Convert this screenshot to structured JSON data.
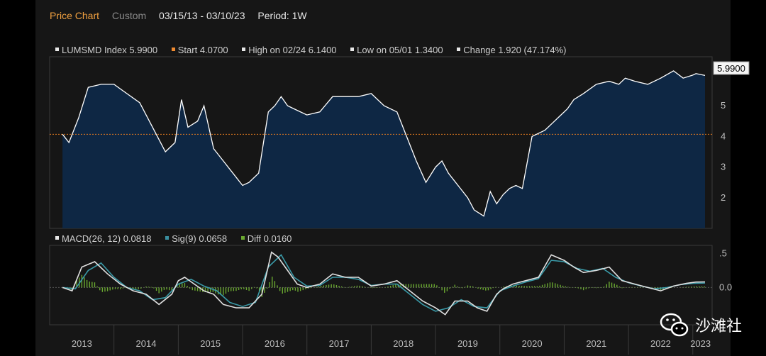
{
  "toolbar": {
    "title": "Price Chart",
    "mode": "Custom",
    "date_range": "03/15/13 - 03/10/23",
    "period": "Period: 1W"
  },
  "price_legend": [
    {
      "label": "LUMSMD Index 5.9900",
      "color": "#e8e8e8"
    },
    {
      "label": "Start 4.0700",
      "color": "#f08a30"
    },
    {
      "label": "High on 02/24 6.1400",
      "color": "#e8e8e8"
    },
    {
      "label": "Low on 05/01 1.3400",
      "color": "#e8e8e8"
    },
    {
      "label": "Change 1.920 (47.174%)",
      "color": "#e8e8e8"
    }
  ],
  "macd_legend": [
    {
      "label": "MACD(26, 12) 0.0818",
      "color": "#e8e8e8"
    },
    {
      "label": "Sig(9) 0.0658",
      "color": "#3a8fa0"
    },
    {
      "label": "Diff 0.0160",
      "color": "#6aa830"
    }
  ],
  "last_price_tag": "5.9900",
  "watermark": "沙滩社",
  "colors": {
    "area_fill": "#0e2744",
    "price_line": "#ffffff",
    "start_line": "#e07a20",
    "macd_line": "#e0e0e0",
    "signal_line": "#3a9aa8",
    "diff_bar": "#6aa830"
  },
  "chart_data": [
    {
      "type": "area",
      "series": [
        {
          "name": "LUMSMD Index"
        }
      ],
      "x": [
        2013.2,
        2013.3,
        2013.45,
        2013.6,
        2013.8,
        2014.0,
        2014.2,
        2014.4,
        2014.6,
        2014.8,
        2014.95,
        2015.05,
        2015.15,
        2015.3,
        2015.4,
        2015.55,
        2015.7,
        2015.85,
        2016.0,
        2016.1,
        2016.25,
        2016.4,
        2016.5,
        2016.6,
        2016.7,
        2016.8,
        2017.0,
        2017.2,
        2017.4,
        2017.6,
        2017.8,
        2018.0,
        2018.2,
        2018.4,
        2018.55,
        2018.7,
        2018.85,
        2019.0,
        2019.1,
        2019.2,
        2019.35,
        2019.5,
        2019.6,
        2019.75,
        2019.85,
        2019.95,
        2020.05,
        2020.15,
        2020.25,
        2020.35,
        2020.5,
        2020.7,
        2020.85,
        2020.95,
        2021.05,
        2021.15,
        2021.3,
        2021.5,
        2021.7,
        2021.85,
        2021.95,
        2022.1,
        2022.3,
        2022.5,
        2022.7,
        2022.85,
        2023.0,
        2023.05,
        2023.19
      ],
      "y": [
        4.07,
        3.8,
        4.6,
        5.6,
        5.7,
        5.7,
        5.4,
        5.1,
        4.3,
        3.5,
        3.8,
        5.2,
        4.3,
        4.5,
        5.0,
        3.6,
        3.2,
        2.8,
        2.4,
        2.5,
        2.8,
        4.8,
        5.0,
        5.3,
        5.0,
        4.9,
        4.7,
        4.8,
        5.3,
        5.3,
        5.3,
        5.4,
        5.0,
        4.8,
        4.0,
        3.2,
        2.5,
        3.0,
        3.2,
        2.8,
        2.4,
        2.0,
        1.6,
        1.4,
        2.2,
        1.8,
        2.1,
        2.3,
        2.4,
        2.3,
        4.0,
        4.2,
        4.5,
        4.7,
        4.9,
        5.2,
        5.4,
        5.7,
        5.8,
        5.7,
        5.9,
        5.8,
        5.7,
        5.9,
        6.14,
        5.9,
        6.0,
        6.05,
        5.99
      ],
      "start": 4.07,
      "yticks": [
        2,
        3,
        4,
        5
      ],
      "ylim": [
        1.0,
        6.6
      ],
      "last_value": 5.99
    },
    {
      "type": "line",
      "series": [
        {
          "name": "MACD(26, 12)",
          "x": [
            2013.2,
            2013.35,
            2013.5,
            2013.7,
            2013.9,
            2014.1,
            2014.3,
            2014.5,
            2014.7,
            2014.9,
            2015.0,
            2015.1,
            2015.25,
            2015.4,
            2015.55,
            2015.7,
            2015.9,
            2016.1,
            2016.3,
            2016.45,
            2016.55,
            2016.7,
            2016.85,
            2017.0,
            2017.2,
            2017.4,
            2017.6,
            2017.8,
            2018.0,
            2018.2,
            2018.4,
            2018.6,
            2018.8,
            2019.0,
            2019.15,
            2019.3,
            2019.5,
            2019.65,
            2019.8,
            2019.95,
            2020.05,
            2020.2,
            2020.4,
            2020.6,
            2020.8,
            2021.0,
            2021.15,
            2021.3,
            2021.5,
            2021.7,
            2021.9,
            2022.1,
            2022.3,
            2022.5,
            2022.7,
            2022.9,
            2023.05,
            2023.19
          ],
          "values": [
            0.0,
            -0.05,
            0.3,
            0.38,
            0.2,
            0.05,
            -0.05,
            -0.1,
            -0.25,
            -0.1,
            0.1,
            0.15,
            0.05,
            -0.05,
            -0.1,
            -0.25,
            -0.3,
            -0.3,
            -0.1,
            0.52,
            0.45,
            0.25,
            0.05,
            0.0,
            0.05,
            0.2,
            0.15,
            0.15,
            0.02,
            0.05,
            0.1,
            -0.05,
            -0.2,
            -0.3,
            -0.4,
            -0.2,
            -0.2,
            -0.3,
            -0.35,
            -0.1,
            -0.02,
            0.05,
            0.1,
            0.15,
            0.48,
            0.4,
            0.3,
            0.22,
            0.25,
            0.3,
            0.1,
            0.05,
            0.0,
            -0.05,
            0.02,
            0.06,
            0.08,
            0.0818
          ]
        },
        {
          "name": "Sig(9)",
          "x": [
            2013.2,
            2013.4,
            2013.6,
            2013.8,
            2014.0,
            2014.2,
            2014.4,
            2014.6,
            2014.8,
            2015.0,
            2015.2,
            2015.4,
            2015.6,
            2015.8,
            2016.0,
            2016.2,
            2016.4,
            2016.6,
            2016.8,
            2017.0,
            2017.2,
            2017.4,
            2017.6,
            2017.8,
            2018.0,
            2018.2,
            2018.4,
            2018.6,
            2018.8,
            2019.0,
            2019.2,
            2019.4,
            2019.6,
            2019.8,
            2020.0,
            2020.2,
            2020.4,
            2020.6,
            2020.8,
            2021.0,
            2021.2,
            2021.4,
            2021.6,
            2021.8,
            2022.0,
            2022.2,
            2022.4,
            2022.6,
            2022.8,
            2023.0,
            2023.19
          ],
          "values": [
            0.0,
            -0.02,
            0.25,
            0.36,
            0.15,
            0.0,
            -0.05,
            -0.18,
            -0.15,
            0.05,
            0.12,
            0.02,
            -0.05,
            -0.22,
            -0.28,
            -0.22,
            0.3,
            0.48,
            0.15,
            0.02,
            0.03,
            0.15,
            0.15,
            0.12,
            0.03,
            0.05,
            0.05,
            -0.1,
            -0.25,
            -0.35,
            -0.3,
            -0.18,
            -0.28,
            -0.3,
            -0.05,
            0.02,
            0.08,
            0.13,
            0.4,
            0.38,
            0.28,
            0.24,
            0.28,
            0.15,
            0.07,
            0.02,
            -0.02,
            0.0,
            0.04,
            0.06,
            0.0658
          ]
        }
      ],
      "bars": {
        "name": "Diff",
        "last_value": 0.016
      },
      "yticks": [
        0.5,
        0.0
      ],
      "ytick_labels": [
        ".5",
        "0.0"
      ],
      "ylim": [
        -0.55,
        0.62
      ]
    }
  ],
  "x_axis": {
    "labels": [
      "2013",
      "2014",
      "2015",
      "2016",
      "2017",
      "2018",
      "2019",
      "2020",
      "2021",
      "2022",
      "2023"
    ]
  }
}
